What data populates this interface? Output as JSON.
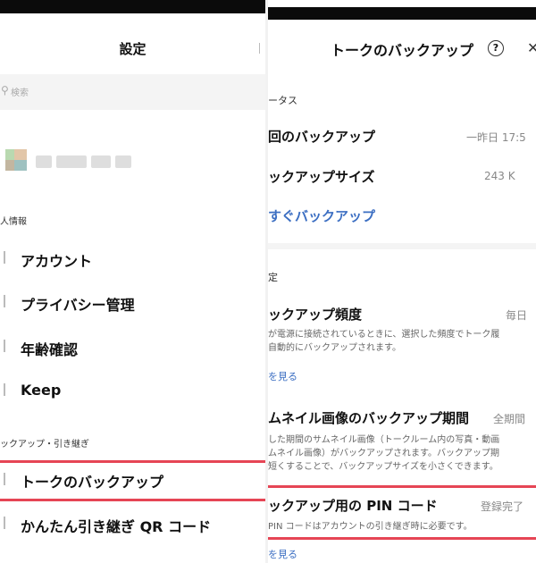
{
  "left": {
    "title": "設定",
    "search_icon": "search-icon",
    "search_placeholder": "検索",
    "section_personal": "人情報",
    "items": [
      {
        "label": "アカウント"
      },
      {
        "label": "プライバシー管理"
      },
      {
        "label": "年齢確認"
      },
      {
        "label": "Keep"
      }
    ],
    "section_backup": "ックアップ・引き継ぎ",
    "backup_items": [
      {
        "label": "トークのバックアップ"
      },
      {
        "label": "かんたん引き継ぎ QR コード"
      }
    ],
    "highlight_color": "#e64555"
  },
  "right": {
    "title": "トークのバックアップ",
    "help_icon": "?",
    "close_icon": "✕",
    "section_status": "ータス",
    "last_backup_label": "回のバックアップ",
    "last_backup_value": "一昨日 17:5",
    "size_label": "ックアップサイズ",
    "size_value": "243 K",
    "backup_now": "すぐバックアップ",
    "section_settings": "定",
    "frequency_label": "ックアップ頻度",
    "frequency_value": "毎日",
    "frequency_desc_1": "が電源に接続されているときに、選択した頻度でトーク履",
    "frequency_desc_2": "自動的にバックアップされます。",
    "details_link": "を見る",
    "thumb_label": "ムネイル画像のバックアップ期間",
    "thumb_value": "全期間",
    "thumb_desc_1": "した期間のサムネイル画像（トークルーム内の写真・動画",
    "thumb_desc_2": "ムネイル画像）がバックアップされます。バックアップ期",
    "thumb_desc_3": "短くすることで、バックアップサイズを小さくできます。",
    "pin_label": "ックアップ用の PIN コード",
    "pin_value": "登録完了",
    "pin_desc": "PIN コードはアカウントの引き継ぎ時に必要です。",
    "bottom_link": "を見る",
    "link_color": "#3b6ec2"
  }
}
